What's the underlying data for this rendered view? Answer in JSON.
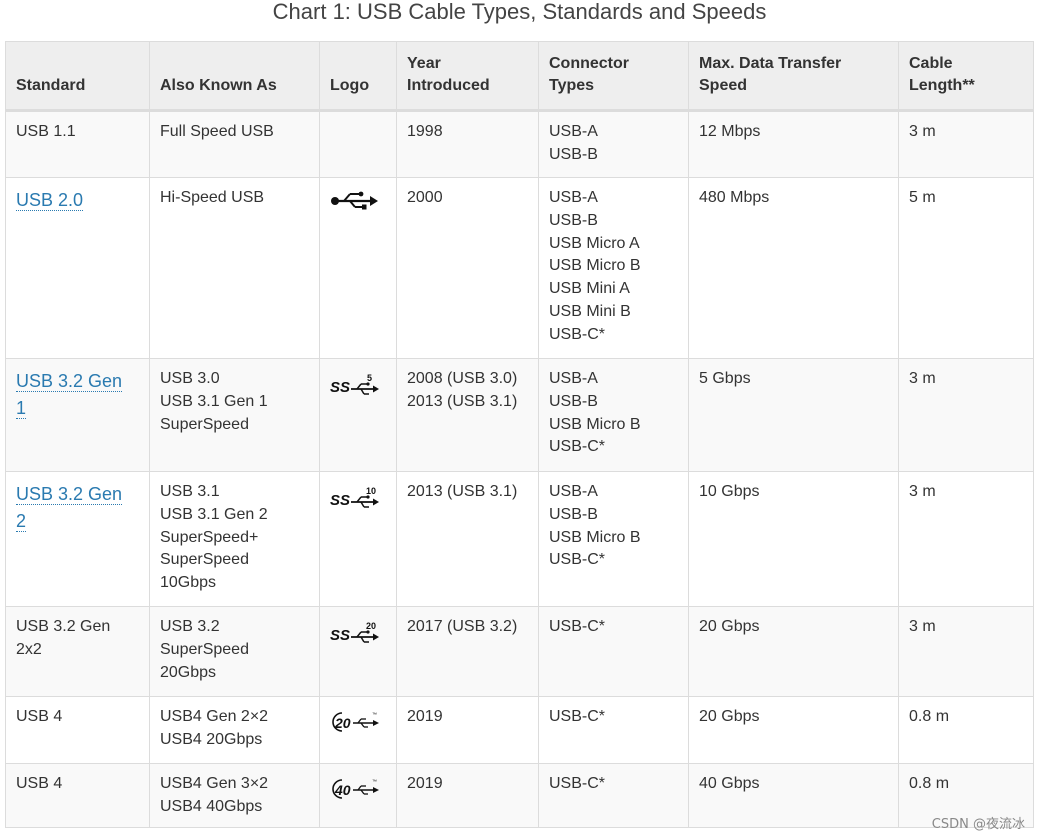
{
  "title": "Chart 1: USB Cable Types, Standards and Speeds",
  "headers": {
    "standard": "Standard",
    "aka": "Also Known As",
    "logo": "Logo",
    "year_1": "Year",
    "year_2": "Introduced",
    "connector_1": "Connector",
    "connector_2": "Types",
    "speed_1": "Max. Data Transfer",
    "speed_2": "Speed",
    "length_1": "Cable",
    "length_2": "Length**"
  },
  "rows": [
    {
      "standard": "USB 1.1",
      "aka": [
        "Full Speed USB"
      ],
      "logo": {
        "icon": "none"
      },
      "year": [
        "1998"
      ],
      "connectors": [
        "USB-A",
        "USB-B"
      ],
      "speed": "12 Mbps",
      "length": "3 m"
    },
    {
      "standard_link": "USB 2.0",
      "aka": [
        "Hi-Speed USB"
      ],
      "logo": {
        "icon": "usb-trident-icon"
      },
      "year": [
        "2000"
      ],
      "connectors": [
        "USB-A",
        "USB-B",
        "USB Micro A",
        "USB Micro B",
        "USB Mini A",
        "USB Mini B",
        "USB-C*"
      ],
      "speed": "480 Mbps",
      "length": "5 m"
    },
    {
      "standard_link_1": "USB 3.2 Gen",
      "standard_link_2": "1",
      "aka": [
        "USB 3.0",
        "USB 3.1 Gen 1",
        "SuperSpeed"
      ],
      "logo": {
        "icon": "superspeed-5-icon",
        "ss": "SS",
        "num": "5"
      },
      "year": [
        "2008 (USB 3.0)",
        "2013 (USB 3.1)"
      ],
      "connectors": [
        "USB-A",
        "USB-B",
        "USB Micro B",
        "USB-C*"
      ],
      "speed": "5 Gbps",
      "length": "3 m"
    },
    {
      "standard_link_1": "USB 3.2 Gen",
      "standard_link_2": "2",
      "aka": [
        "USB 3.1",
        "USB 3.1 Gen 2",
        "SuperSpeed+",
        "SuperSpeed",
        "10Gbps"
      ],
      "logo": {
        "icon": "superspeed-10-icon",
        "ss": "SS",
        "num": "10"
      },
      "year": [
        "2013 (USB 3.1)"
      ],
      "connectors": [
        "USB-A",
        "USB-B",
        "USB Micro B",
        "USB-C*"
      ],
      "speed": "10 Gbps",
      "length": "3 m"
    },
    {
      "standard_1": "USB 3.2 Gen",
      "standard_2": "2x2",
      "aka": [
        "USB 3.2",
        "SuperSpeed",
        "20Gbps"
      ],
      "logo": {
        "icon": "superspeed-20-icon",
        "ss": "SS",
        "num": "20"
      },
      "year": [
        "2017 (USB 3.2)"
      ],
      "connectors": [
        "USB-C*"
      ],
      "speed": "20 Gbps",
      "length": "3 m"
    },
    {
      "standard": "USB 4",
      "aka": [
        "USB4 Gen 2×2",
        "USB4 20Gbps"
      ],
      "logo": {
        "icon": "usb4-20-icon",
        "num": "20",
        "tm": "™"
      },
      "year": [
        "2019"
      ],
      "connectors": [
        "USB-C*"
      ],
      "speed": "20 Gbps",
      "length": "0.8 m"
    },
    {
      "standard": "USB 4",
      "aka": [
        "USB4 Gen 3×2",
        "USB4 40Gbps"
      ],
      "logo": {
        "icon": "usb4-40-icon",
        "num": "40",
        "tm": "™"
      },
      "year": [
        "2019"
      ],
      "connectors": [
        "USB-C*"
      ],
      "speed": "40 Gbps",
      "length": "0.8 m"
    }
  ],
  "watermark": "CSDN @夜流冰"
}
